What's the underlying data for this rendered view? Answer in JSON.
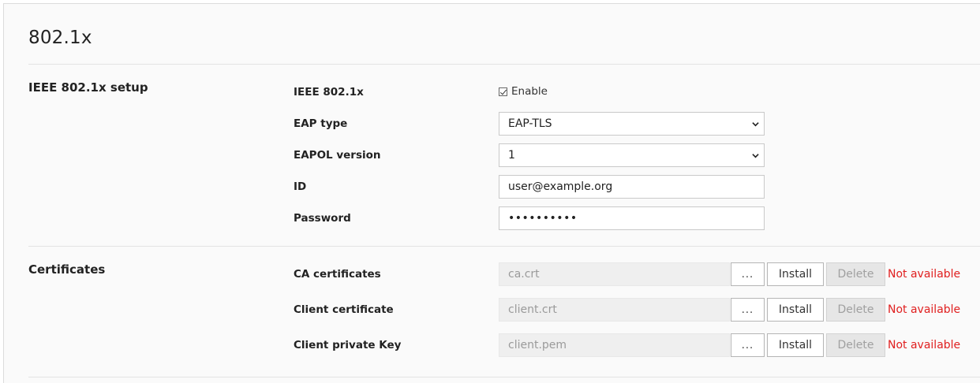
{
  "page": {
    "title": "802.1x"
  },
  "setup": {
    "section_title": "IEEE 802.1x setup",
    "ieee": {
      "label": "IEEE 802.1x",
      "checkbox_label": "Enable",
      "checked": true
    },
    "eap_type": {
      "label": "EAP type",
      "value": "EAP-TLS"
    },
    "eapol_version": {
      "label": "EAPOL version",
      "value": "1"
    },
    "id": {
      "label": "ID",
      "value": "user@example.org"
    },
    "password": {
      "label": "Password",
      "value": "••••••••••"
    }
  },
  "certificates": {
    "section_title": "Certificates",
    "rows": [
      {
        "label": "CA certificates",
        "file": "ca.crt",
        "browse": "...",
        "install": "Install",
        "delete": "Delete",
        "status": "Not available"
      },
      {
        "label": "Client certificate",
        "file": "client.crt",
        "browse": "...",
        "install": "Install",
        "delete": "Delete",
        "status": "Not available"
      },
      {
        "label": "Client private Key",
        "file": "client.pem",
        "browse": "...",
        "install": "Install",
        "delete": "Delete",
        "status": "Not available"
      }
    ]
  },
  "colors": {
    "status_error": "#e02020",
    "disabled_bg": "#e6e6e6",
    "panel_bg": "#fafafa"
  }
}
